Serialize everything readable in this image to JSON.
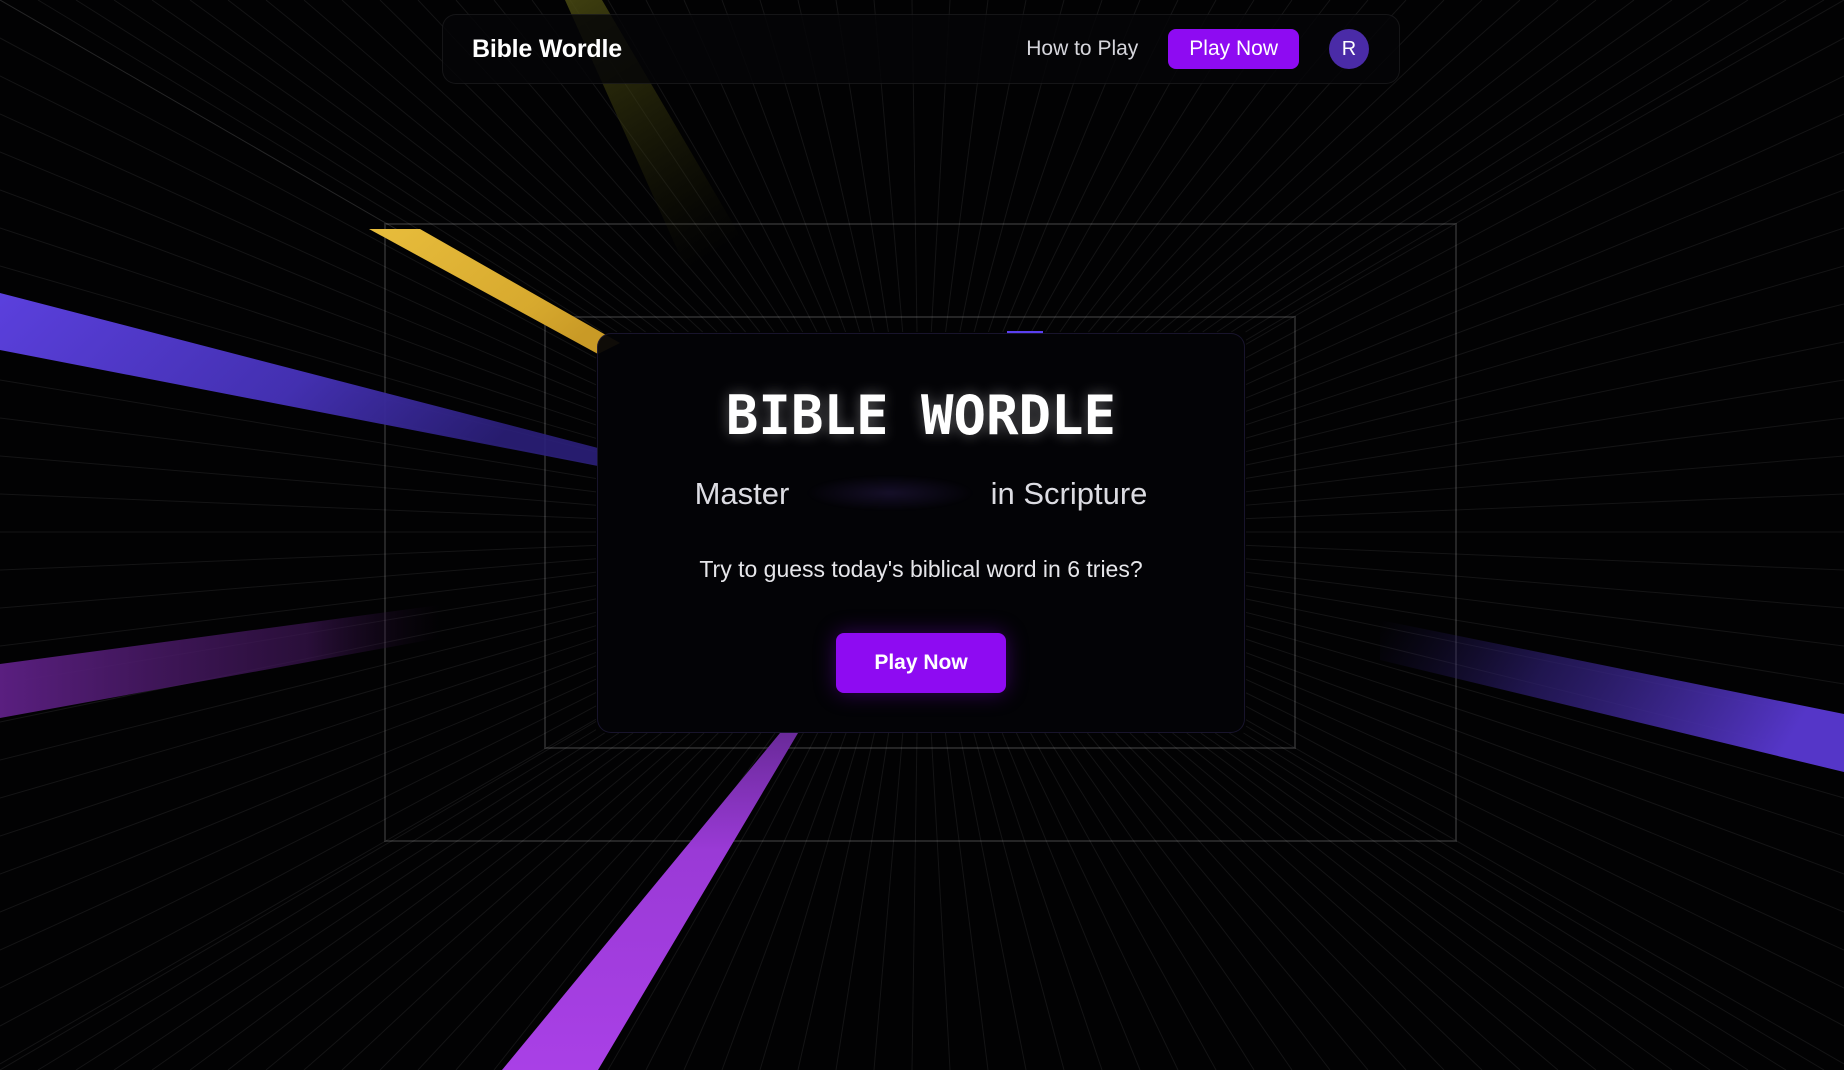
{
  "nav": {
    "brand": "Bible Wordle",
    "how_to_play": "How to Play",
    "play_now": "Play Now",
    "avatar_initial": "R"
  },
  "hero": {
    "title": "BIBLE WORDLE",
    "subtitle_prefix": "Master",
    "subtitle_suffix": "in Scripture",
    "description": "Try to guess today's biblical word in 6 tries?",
    "play_button": "Play Now"
  },
  "colors": {
    "accent_purple": "#8e0bf2",
    "avatar_bg": "#4a2ba7",
    "beam_gold": "#e5b93a",
    "beam_blue": "#5a3fd8",
    "beam_violet": "#a63ee0",
    "background": "#020203"
  }
}
